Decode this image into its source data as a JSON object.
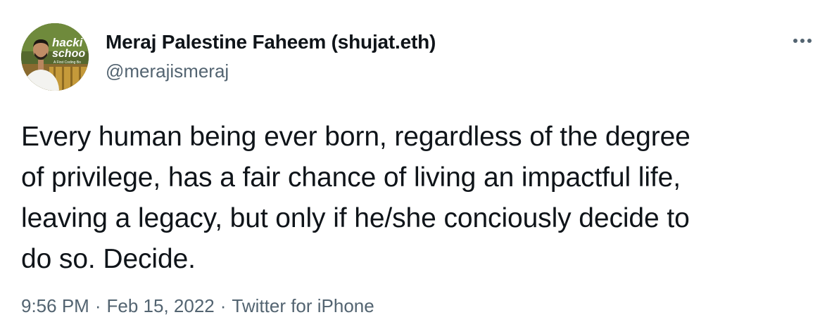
{
  "author": {
    "display_name": "Meraj Palestine Faheem (shujat.eth)",
    "handle": "@merajismeraj",
    "avatar_sign_text_line1": "hacki",
    "avatar_sign_text_line2": "schoo",
    "avatar_sign_text_line3": "A First Coding Bo"
  },
  "more_icon": "ellipsis-icon",
  "tweet": {
    "lines": [
      "Every human being ever born, regardless of the degree",
      "of privilege, has a fair chance of living an impactful life,",
      "leaving a legacy, but only if he/she conciously decide to",
      "do so. Decide."
    ]
  },
  "meta": {
    "time": "9:56 PM",
    "separator": "·",
    "date": "Feb 15, 2022",
    "source": "Twitter for iPhone"
  },
  "colors": {
    "text_primary": "#0f1419",
    "text_secondary": "#536471"
  }
}
